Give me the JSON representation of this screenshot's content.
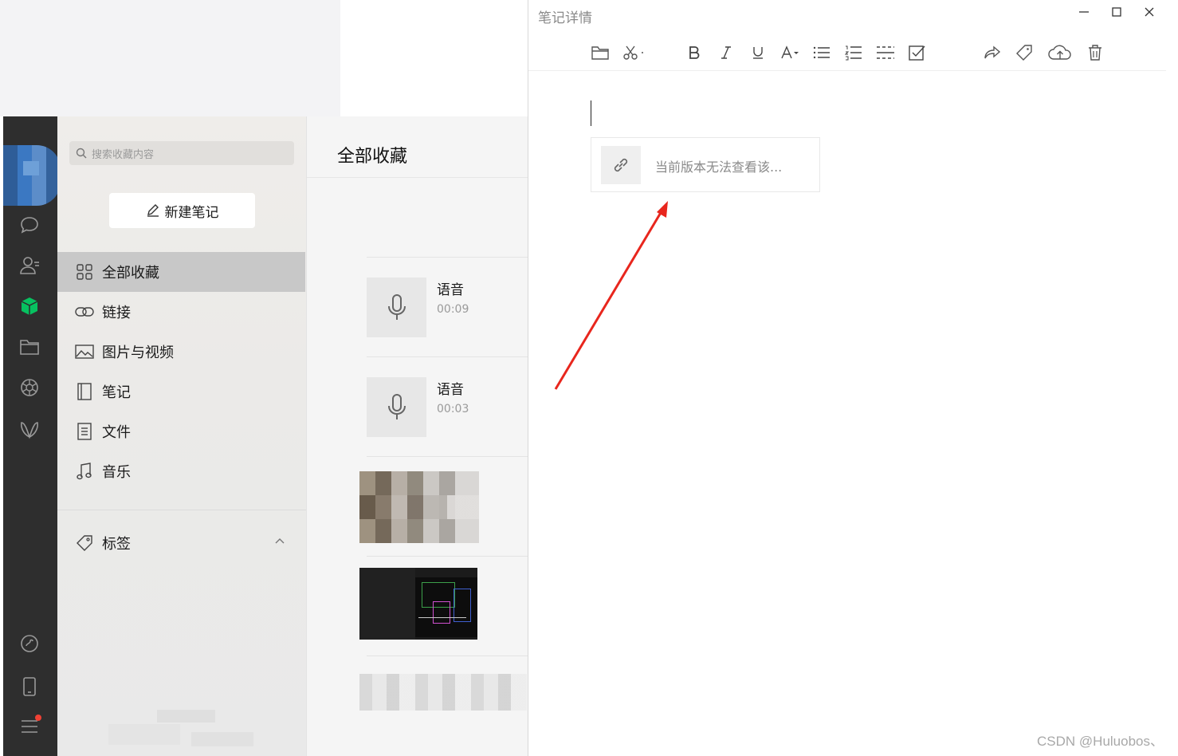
{
  "note_window": {
    "title": "笔记详情",
    "link_card_text": "当前版本无法查看该..."
  },
  "sidebar": {
    "search_placeholder": "搜索收藏内容",
    "new_note_label": "新建笔记",
    "categories": [
      {
        "label": "全部收藏",
        "icon": "grid-icon"
      },
      {
        "label": "链接",
        "icon": "link-icon"
      },
      {
        "label": "图片与视频",
        "icon": "image-icon"
      },
      {
        "label": "笔记",
        "icon": "notebook-icon"
      },
      {
        "label": "文件",
        "icon": "file-icon"
      },
      {
        "label": "音乐",
        "icon": "music-icon"
      }
    ],
    "tags_label": "标签"
  },
  "list": {
    "title": "全部收藏",
    "items": [
      {
        "type": "voice",
        "title": "语音",
        "duration": "00:09"
      },
      {
        "type": "voice",
        "title": "语音",
        "duration": "00:03"
      }
    ]
  },
  "watermark": "CSDN @Huluobos、",
  "colors": {
    "rail_bg": "#2e2e2e",
    "active_green": "#07c160",
    "annotation_red": "#e8261d",
    "notify_red": "#f04134"
  }
}
